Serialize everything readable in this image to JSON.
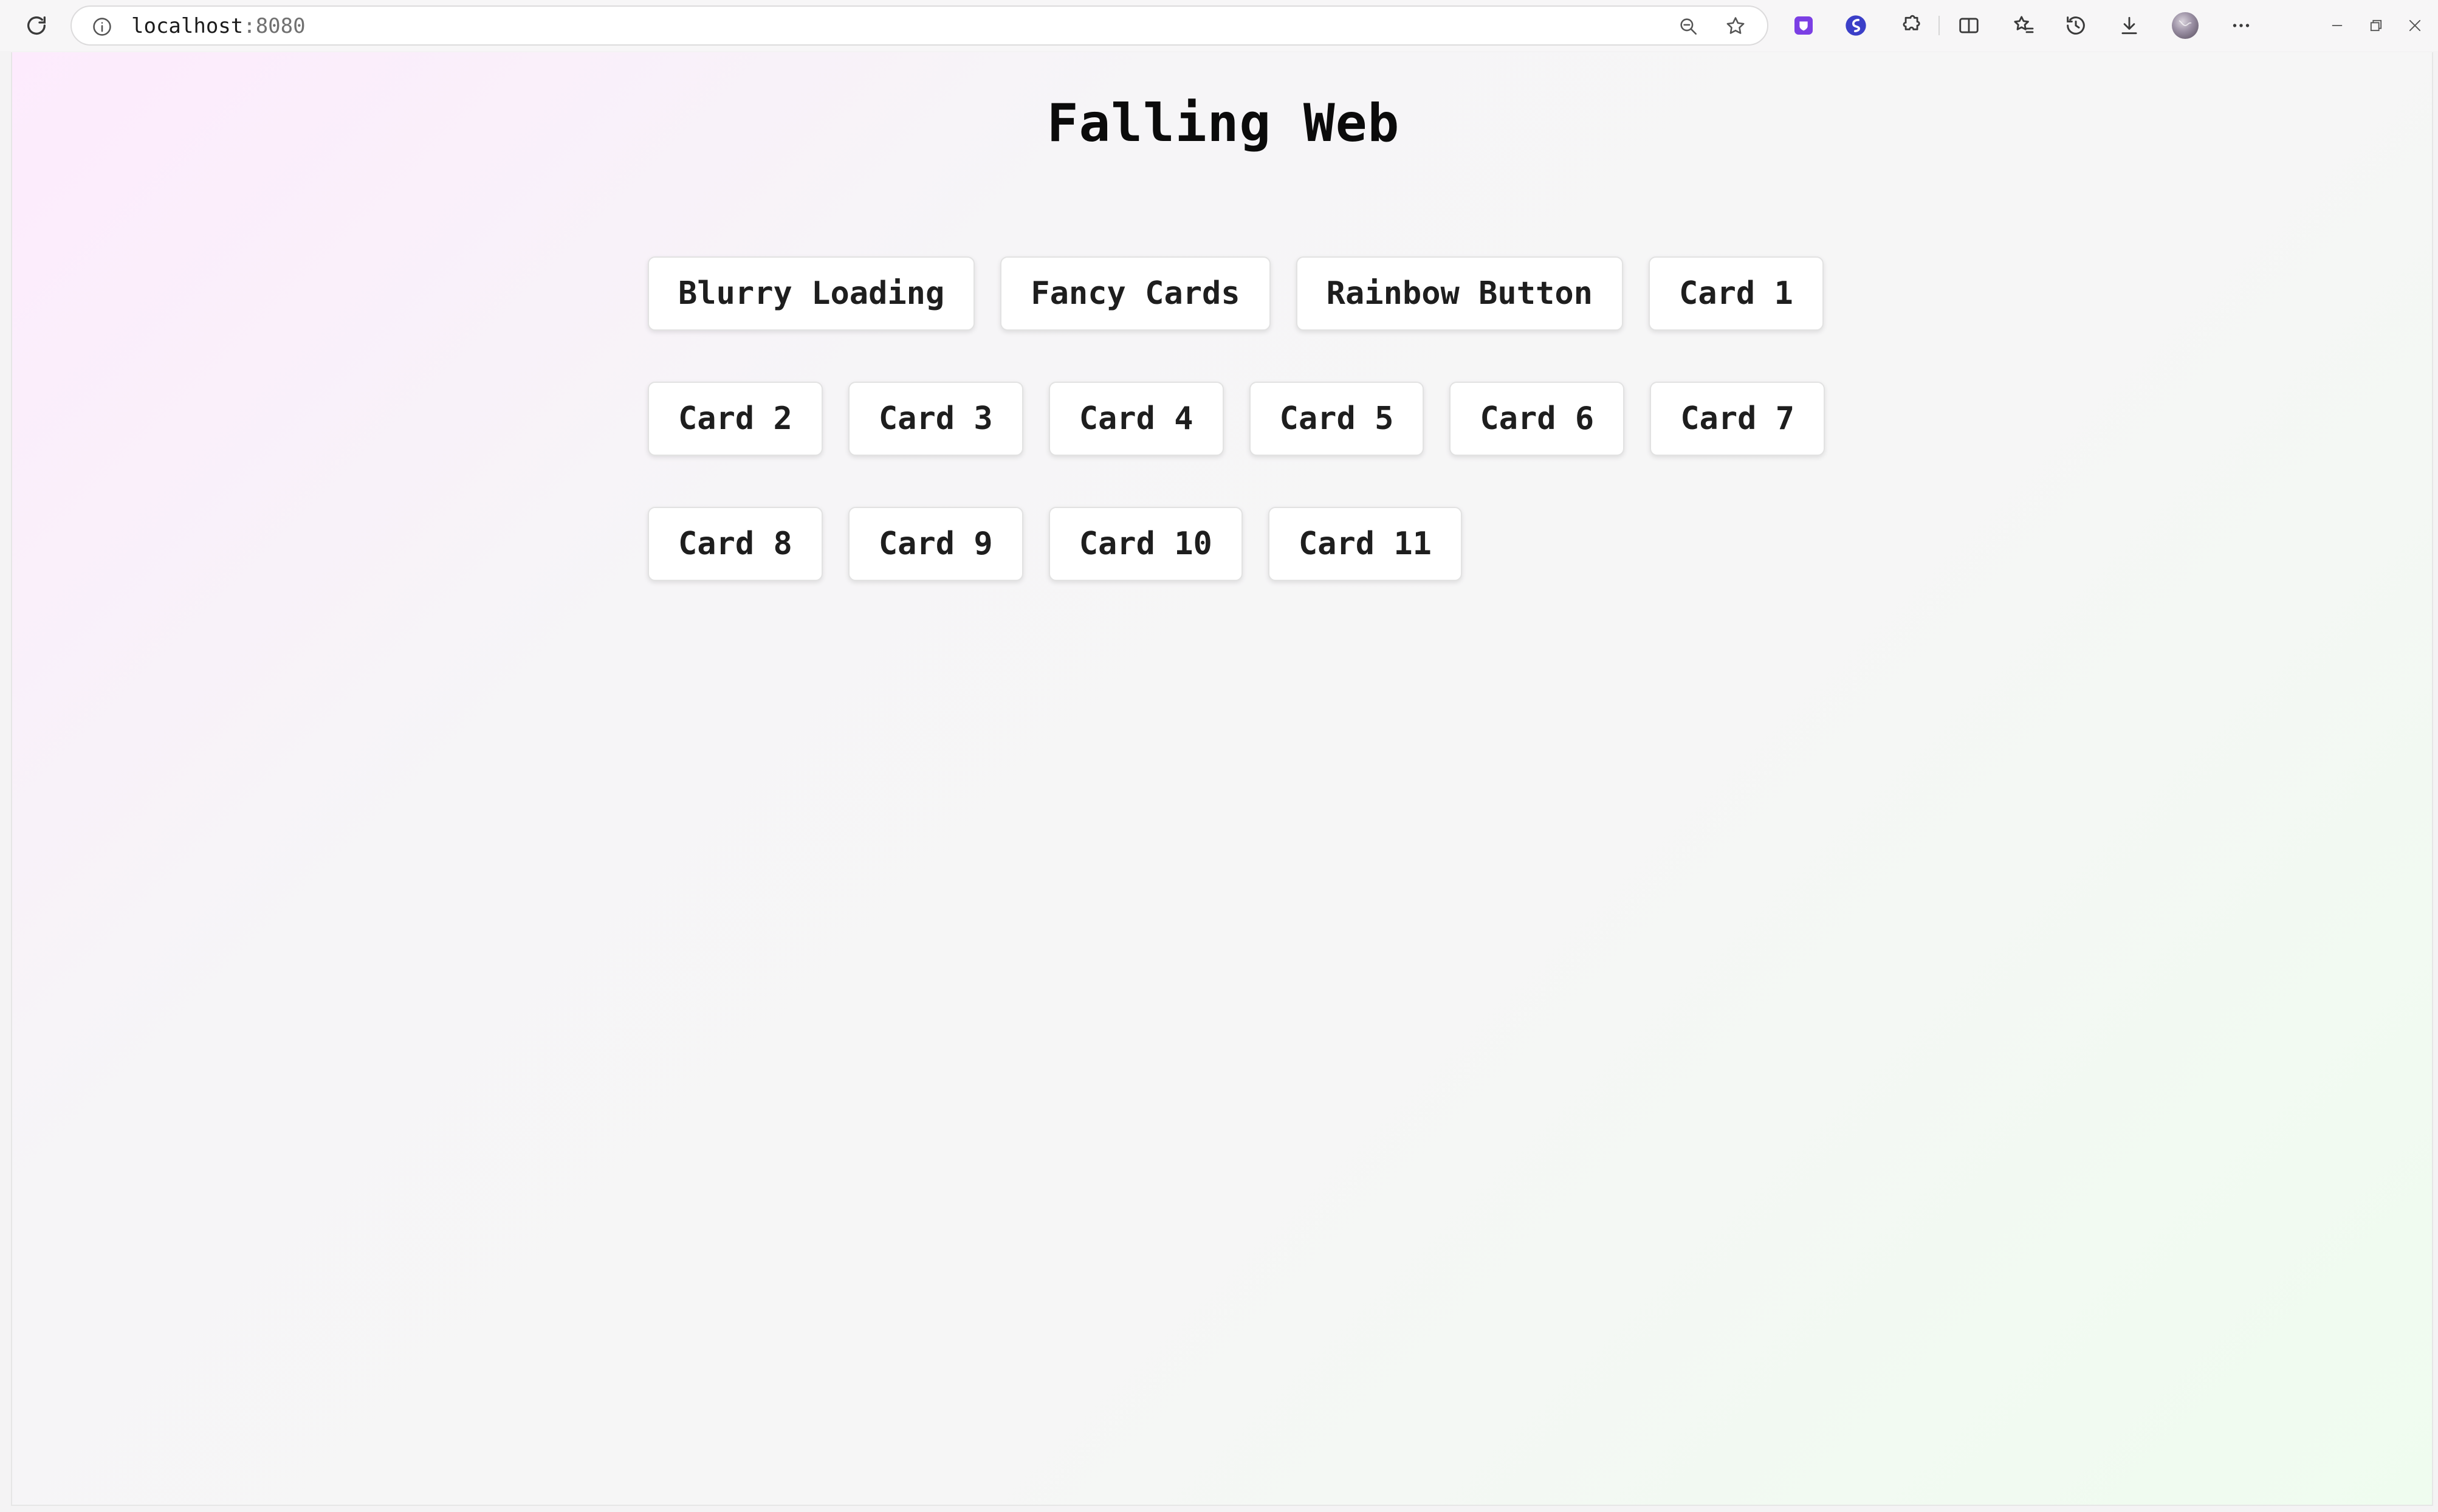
{
  "browser": {
    "url_host": "localhost",
    "url_port": ":8080",
    "colors": {
      "extension_purple": "#7b3fe4",
      "extension_blue": "#3b3fc8"
    },
    "toolbar_icons": [
      "reload-icon",
      "info-icon",
      "zoom-out-icon",
      "bookmark-star-icon",
      "extension-shield-icon",
      "extension-s-icon",
      "puzzle-icon",
      "split-view-icon",
      "favorites-icon",
      "history-icon",
      "download-icon",
      "profile-avatar",
      "more-icon",
      "minimize-icon",
      "restore-icon",
      "close-icon"
    ]
  },
  "page": {
    "title": "Falling Web",
    "cards": [
      {
        "label": "Blurry Loading"
      },
      {
        "label": "Fancy Cards"
      },
      {
        "label": "Rainbow Button"
      },
      {
        "label": "Card 1"
      },
      {
        "label": "Card 2"
      },
      {
        "label": "Card 3"
      },
      {
        "label": "Card 4"
      },
      {
        "label": "Card 5"
      },
      {
        "label": "Card 6"
      },
      {
        "label": "Card 7"
      },
      {
        "label": "Card 8"
      },
      {
        "label": "Card 9"
      },
      {
        "label": "Card 10"
      },
      {
        "label": "Card 11"
      }
    ]
  }
}
